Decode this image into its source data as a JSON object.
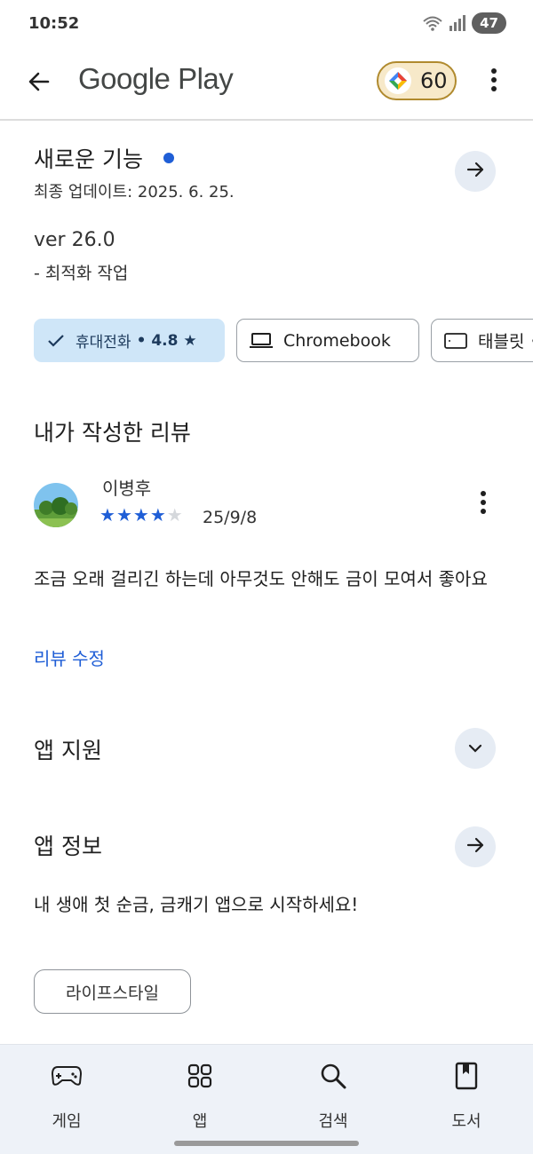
{
  "status_bar": {
    "time": "10:52",
    "battery": "47",
    "network": "5"
  },
  "app_bar": {
    "title": "Google Play",
    "points": "60",
    "back_icon": "arrow-back-icon",
    "points_icon": "play-points-icon",
    "menu_icon": "more-vert-icon"
  },
  "whats_new": {
    "title": "새로운 기능",
    "updated": "최종 업데이트: 2025. 6. 25.",
    "version": "ver 26.0",
    "change": "- 최적화 작업",
    "arrow_icon": "arrow-forward-icon"
  },
  "device_chips": {
    "phone": {
      "label": "휴대전화",
      "rating": "• 4.8 ★",
      "icon": "check-icon"
    },
    "chromebook": {
      "label": "Chromebook",
      "icon": "laptop-icon"
    },
    "tablet": {
      "label": "태블릿 •",
      "icon": "tablet-icon"
    }
  },
  "my_review": {
    "heading": "내가 작성한 리뷰",
    "reviewer": "이병후",
    "rating": 4,
    "max_rating": 5,
    "date": "25/9/8",
    "body": "조금 오래 걸리긴 하는데 아무것도 안해도 금이 모여서 좋아요",
    "edit_label": "리뷰 수정",
    "menu_icon": "more-vert-icon"
  },
  "app_support": {
    "title": "앱 지원",
    "icon": "chevron-down-icon"
  },
  "app_info": {
    "title": "앱 정보",
    "description": "내 생애 첫 순금, 금캐기 앱으로 시작하세요!",
    "category": "라이프스타일",
    "icon": "arrow-forward-icon"
  },
  "bottom_nav": {
    "items": [
      {
        "label": "게임",
        "icon": "gamepad-icon"
      },
      {
        "label": "앱",
        "icon": "apps-grid-icon"
      },
      {
        "label": "검색",
        "icon": "search-icon"
      },
      {
        "label": "도서",
        "icon": "book-icon"
      }
    ]
  },
  "colors": {
    "accent": "#1f5ed6",
    "chip_selected": "#cfe6f8",
    "points_bg": "#f7e9c9",
    "nav_bg": "#eef2f8"
  }
}
